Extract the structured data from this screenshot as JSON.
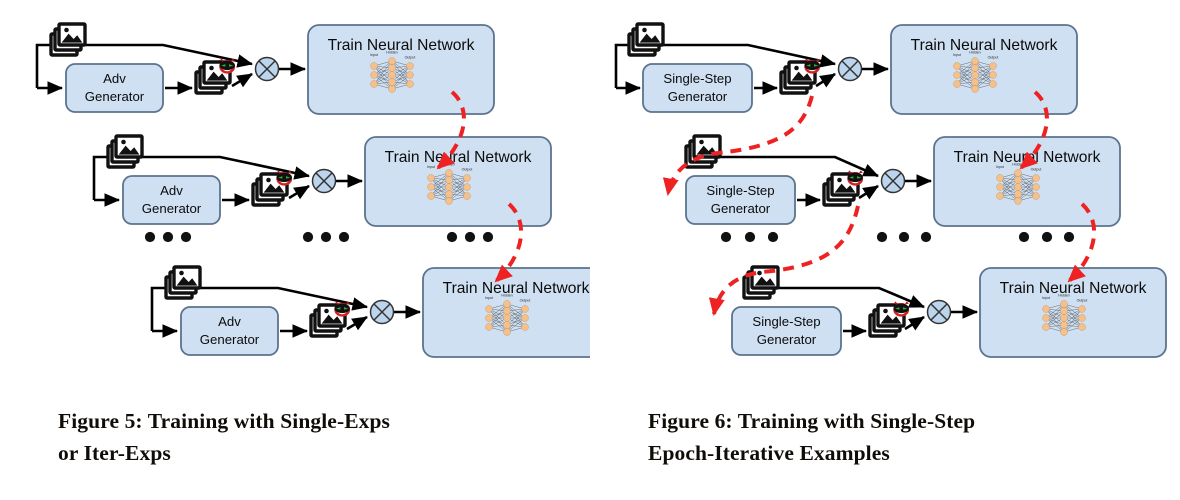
{
  "figure": {
    "type": "two-panel-schematic-diagram",
    "background_color": "#ffffff",
    "palette": {
      "box_fill": "#cfe0f2",
      "box_stroke": "#5b738f",
      "arrow_black": "#000000",
      "arrow_red": "#ee2222",
      "node_orange": "#f5c089",
      "merge_fill": "#bcd5ec",
      "text": "#0b0b0b"
    }
  },
  "panels": [
    {
      "id": "left",
      "caption": {
        "lines": [
          "Figure 5: Training with Single-Exps",
          "or Iter-Exps"
        ]
      },
      "generator_label_lines": [
        "Adv",
        "Generator"
      ],
      "nn_label": "Train Neural Network",
      "nn_layer_labels": [
        "Input",
        "Hidden",
        "Output"
      ],
      "merge_node": "cross-circle-combine",
      "rows": [
        {
          "index": 1,
          "clean_images": "image-stack",
          "adv_images": "adversarial-image-stack"
        },
        {
          "index": 2,
          "clean_images": "image-stack",
          "adv_images": "adversarial-image-stack"
        },
        {
          "index": 3,
          "clean_images": "image-stack",
          "adv_images": "adversarial-image-stack"
        }
      ],
      "ellipsis_groups": 3,
      "ellipsis_dots_per_group": 3,
      "red_feedback": "model-to-next-model"
    },
    {
      "id": "right",
      "caption": {
        "lines": [
          "Figure 6: Training with Single-Step",
          "Epoch-Iterative Examples"
        ]
      },
      "generator_label_lines": [
        "Single-Step",
        "Generator"
      ],
      "nn_label": "Train Neural Network",
      "nn_layer_labels": [
        "Input",
        "Hidden",
        "Output"
      ],
      "merge_node": "cross-circle-combine",
      "rows": [
        {
          "index": 1,
          "clean_images": "image-stack",
          "adv_images": "adversarial-image-stack"
        },
        {
          "index": 2,
          "clean_images": "image-stack",
          "adv_images": "adversarial-image-stack"
        },
        {
          "index": 3,
          "clean_images": "image-stack",
          "adv_images": "adversarial-image-stack"
        }
      ],
      "ellipsis_groups": 3,
      "ellipsis_dots_per_group": 3,
      "red_feedback": "model-to-next-model-and-advimages-to-next-generator"
    }
  ]
}
